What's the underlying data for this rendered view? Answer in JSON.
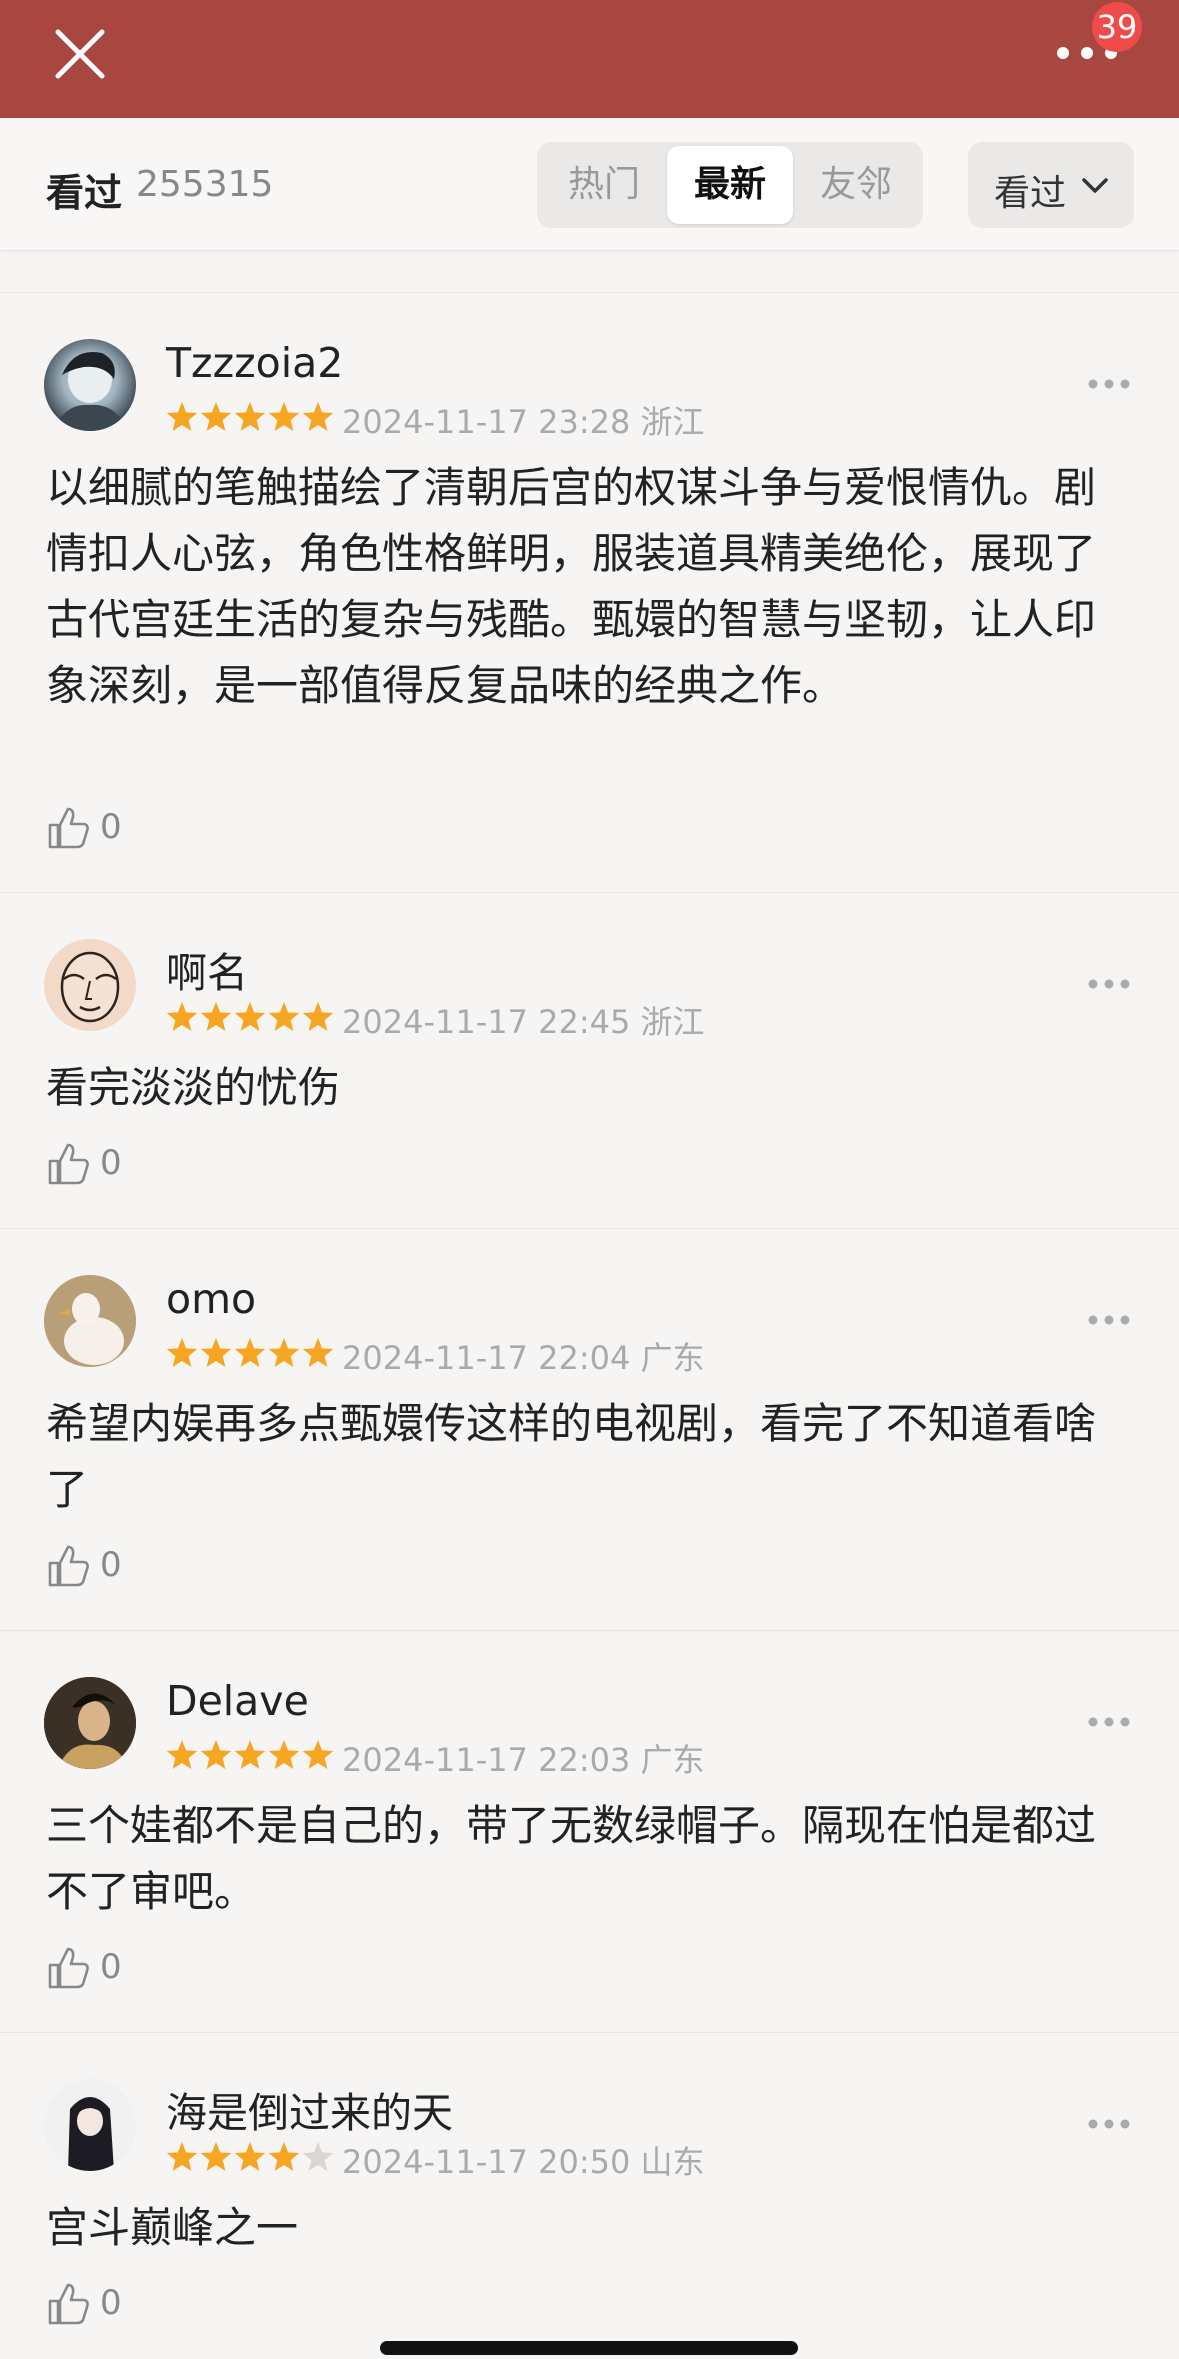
{
  "header": {
    "close_icon": "close-icon",
    "more_icon": "more-horizontal-icon",
    "notification_count": "39",
    "colors": {
      "bar": "#a8473f",
      "badge": "#ef4b4b"
    }
  },
  "filter": {
    "title": "看过",
    "count": "255315",
    "tabs": [
      "热门",
      "最新",
      "友邻"
    ],
    "active_tab": "最新",
    "dropdown_label": "看过",
    "dropdown_icon": "chevron-down-icon"
  },
  "reviews": [
    {
      "username": "Tzzzoia2",
      "rating": 5,
      "date": "2024-11-17 23:28",
      "location": "浙江",
      "text": "以细腻的笔触描绘了清朝后宫的权谋斗争与爱恨情仇。剧情扣人心弦，角色性格鲜明，服装道具精美绝伦，展现了古代宫廷生活的复杂与残酷。甄嬛的智慧与坚韧，让人印象深刻，是一部值得反复品味的经典之作。",
      "likes": "0"
    },
    {
      "username": "啊名",
      "rating": 5,
      "date": "2024-11-17 22:45",
      "location": "浙江",
      "text": "看完淡淡的忧伤",
      "likes": "0"
    },
    {
      "username": "omo",
      "rating": 5,
      "date": "2024-11-17 22:04",
      "location": "广东",
      "text": "希望内娱再多点甄嬛传这样的电视剧，看完了不知道看啥了",
      "likes": "0"
    },
    {
      "username": "Delave",
      "rating": 5,
      "date": "2024-11-17 22:03",
      "location": "广东",
      "text": "三个娃都不是自己的，带了无数绿帽子。隔现在怕是都过不了审吧。",
      "likes": "0"
    },
    {
      "username": "海是倒过来的天",
      "rating": 4,
      "date": "2024-11-17 20:50",
      "location": "山东",
      "text": "宫斗巅峰之一",
      "likes": "0"
    }
  ],
  "icons": {
    "like": "thumbs-up-icon",
    "star": "star-icon",
    "review_more": "more-horizontal-icon"
  },
  "star_color": "#f6a623",
  "star_empty_color": "#d9d6d4"
}
